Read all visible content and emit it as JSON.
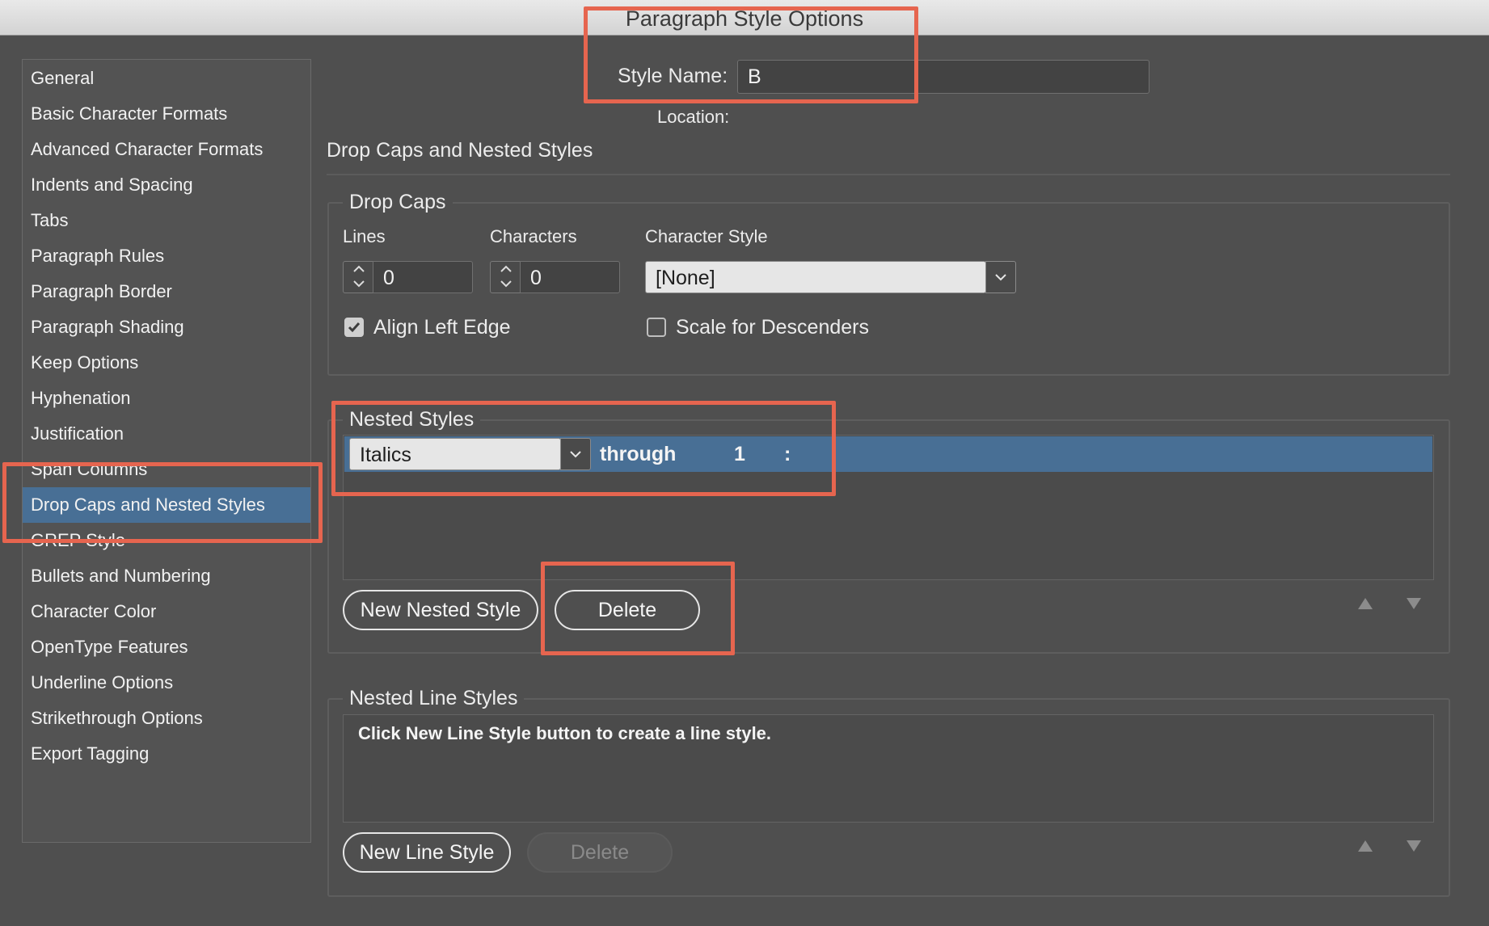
{
  "window": {
    "title": "Paragraph Style Options"
  },
  "header": {
    "style_name_label": "Style Name:",
    "style_name_value": "B",
    "location_label": "Location:"
  },
  "sidebar": {
    "items": [
      {
        "label": "General"
      },
      {
        "label": "Basic Character Formats"
      },
      {
        "label": "Advanced Character Formats"
      },
      {
        "label": "Indents and Spacing"
      },
      {
        "label": "Tabs"
      },
      {
        "label": "Paragraph Rules"
      },
      {
        "label": "Paragraph Border"
      },
      {
        "label": "Paragraph Shading"
      },
      {
        "label": "Keep Options"
      },
      {
        "label": "Hyphenation"
      },
      {
        "label": "Justification"
      },
      {
        "label": "Span Columns"
      },
      {
        "label": "Drop Caps and Nested Styles"
      },
      {
        "label": "GREP Style"
      },
      {
        "label": "Bullets and Numbering"
      },
      {
        "label": "Character Color"
      },
      {
        "label": "OpenType Features"
      },
      {
        "label": "Underline Options"
      },
      {
        "label": "Strikethrough Options"
      },
      {
        "label": "Export Tagging"
      }
    ],
    "selected_index": 12
  },
  "section_title": "Drop Caps and Nested Styles",
  "drop_caps": {
    "legend": "Drop Caps",
    "lines_label": "Lines",
    "lines_value": "0",
    "characters_label": "Characters",
    "characters_value": "0",
    "char_style_label": "Character Style",
    "char_style_value": "[None]",
    "align_left_edge_label": "Align Left Edge",
    "align_left_edge_checked": true,
    "scale_descenders_label": "Scale for Descenders",
    "scale_descenders_checked": false
  },
  "nested_styles": {
    "legend": "Nested Styles",
    "row": {
      "style": "Italics",
      "mode": "through",
      "count": "1",
      "delimiter": ":"
    },
    "new_button": "New Nested Style",
    "delete_button": "Delete"
  },
  "nested_line_styles": {
    "legend": "Nested Line Styles",
    "empty_message": "Click New Line Style button to create a line style.",
    "new_button": "New Line Style",
    "delete_button": "Delete"
  },
  "colors": {
    "highlight": "#486f95",
    "annotation": "#e6654f",
    "background": "#4f4f4f"
  }
}
